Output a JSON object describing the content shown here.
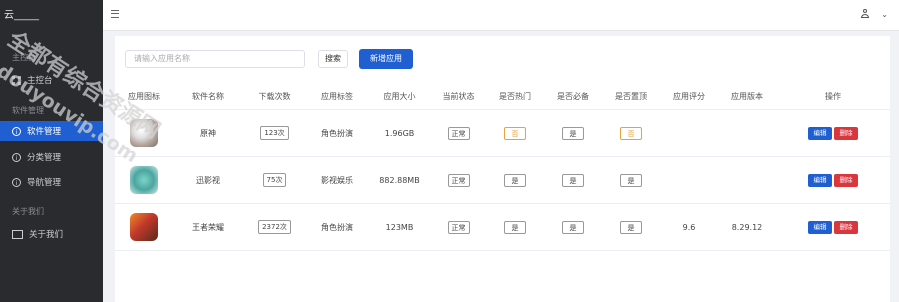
{
  "sidebar": {
    "logo": "云_____",
    "group1": "主控台",
    "group1_item": "主控台",
    "group2": "软件管理",
    "items": [
      {
        "label": "软件管理",
        "icon": "info-circle-icon",
        "active": true
      },
      {
        "label": "分类管理",
        "icon": "info-circle-icon",
        "active": false
      },
      {
        "label": "导航管理",
        "icon": "info-circle-icon",
        "active": false
      }
    ],
    "group3": "关于我们",
    "about_label": "关于我们"
  },
  "toolbar": {
    "search_placeholder": "请输入应用名称",
    "search_label": "搜索",
    "add_label": "新增应用"
  },
  "table": {
    "headers": [
      "应用图标",
      "软件名称",
      "下载次数",
      "应用标签",
      "应用大小",
      "当前状态",
      "是否热门",
      "是否必备",
      "是否置顶",
      "应用评分",
      "应用版本",
      "操作"
    ],
    "rows": [
      {
        "icon": "app-icon-1",
        "name": "原神",
        "downloads": "123次",
        "tag": "角色扮演",
        "size": "1.96GB",
        "status": "正常",
        "hot": "否",
        "must": "是",
        "top": "否",
        "score": "",
        "version": "",
        "edit": "编辑",
        "del": "删除"
      },
      {
        "icon": "app-icon-2",
        "name": "迅影视",
        "downloads": "75次",
        "tag": "影视娱乐",
        "size": "882.88MB",
        "status": "正常",
        "hot": "是",
        "must": "是",
        "top": "是",
        "score": "",
        "version": "",
        "edit": "编辑",
        "del": "删除"
      },
      {
        "icon": "app-icon-3",
        "name": "王者荣耀",
        "downloads": "2372次",
        "tag": "角色扮演",
        "size": "123MB",
        "status": "正常",
        "hot": "是",
        "must": "是",
        "top": "是",
        "score": "9.6",
        "version": "8.29.12",
        "edit": "编辑",
        "del": "删除"
      }
    ]
  },
  "watermark": {
    "line1": "全都有综合资源网",
    "line2": "douyouvip.com"
  },
  "colors": {
    "primary": "#1f5fd1",
    "danger": "#d9363e",
    "warning": "#e6a23c",
    "sidebar": "#2a2b2f"
  }
}
